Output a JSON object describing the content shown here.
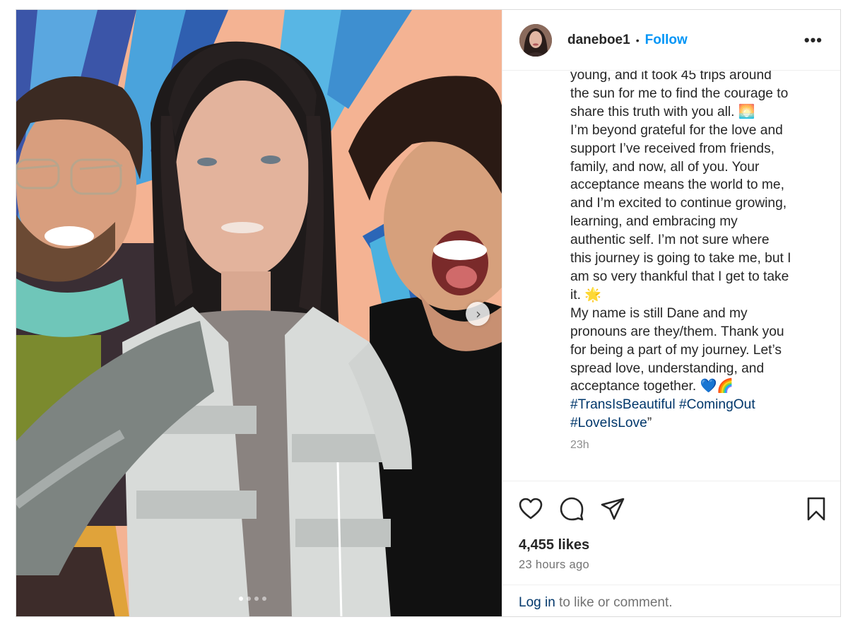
{
  "post": {
    "username": "daneboe1",
    "separator": "•",
    "follow_label": "Follow",
    "more_label": "•••",
    "caption_lines": [
      "young, and it took 45 trips around",
      "the sun for me to find the courage to",
      "share this truth with you all. 🌅",
      "I’m beyond grateful for the love and",
      "support I’ve received from friends,",
      "family, and now, all of you. Your",
      "acceptance means the world to me,",
      "and I’m excited to continue growing,",
      "learning, and embracing my",
      "authentic self. I’m not sure where",
      "this journey is going to take me, but I",
      "am so very thankful that I get to take",
      "it. 🌟",
      "My name is still Dane and my",
      "pronouns are they/them. Thank you",
      "for being a part of my journey. Let’s",
      "spread love, understanding, and",
      "acceptance together. 💙🌈"
    ],
    "hashtags_line1": [
      "#TransIsBeautiful",
      "#ComingOut"
    ],
    "hashtags_line2": "#LoveIsLove",
    "caption_end": "”",
    "caption_time": "23h",
    "likes": "4,455 likes",
    "posted_ago": "23 hours ago",
    "login_link": "Log in",
    "login_rest": " to like or comment.",
    "carousel": {
      "slide_count": 4,
      "active_index": 0,
      "next_label": "›"
    }
  },
  "colors": {
    "follow_blue": "#0095f6",
    "hashtag_blue": "#00376b",
    "muted_gray": "#737373",
    "wall_peach": "#f6b89a",
    "stripe_blue": "#3d9fd6"
  },
  "icons": {
    "like": "heart-outline-icon",
    "comment": "speech-bubble-icon",
    "share": "paper-plane-icon",
    "save": "bookmark-icon",
    "more": "ellipsis-icon",
    "next": "chevron-right-icon"
  }
}
